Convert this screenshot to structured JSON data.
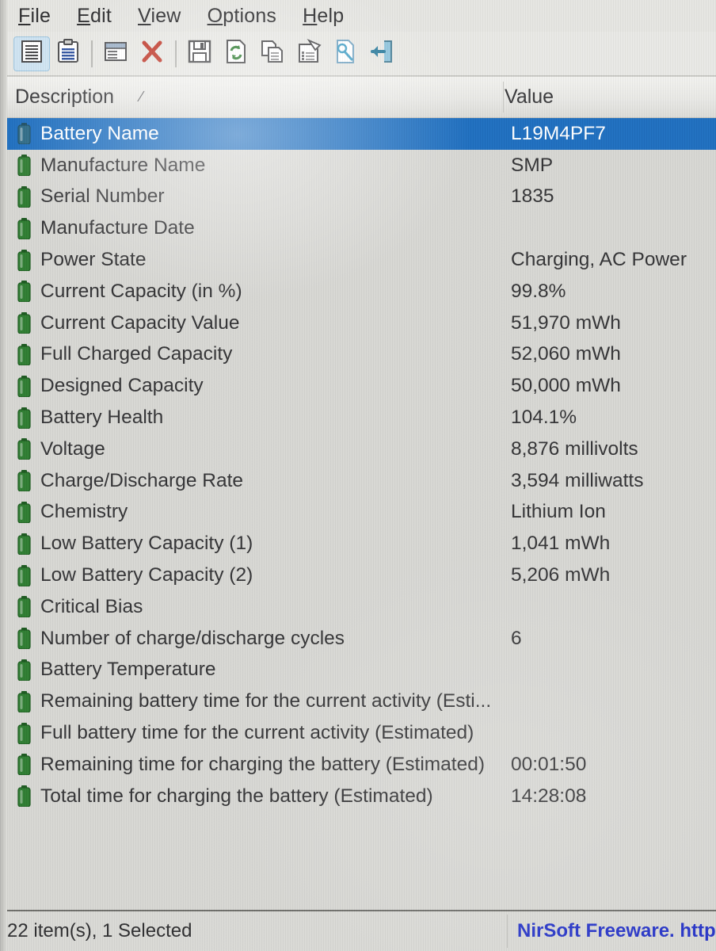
{
  "app": {
    "title": "BatteryInfoView"
  },
  "menubar": {
    "items": [
      {
        "name": "file",
        "label": "File",
        "accel": "F",
        "rest": "ile"
      },
      {
        "name": "edit",
        "label": "Edit",
        "accel": "E",
        "rest": "dit"
      },
      {
        "name": "view",
        "label": "View",
        "accel": "V",
        "rest": "iew"
      },
      {
        "name": "options",
        "label": "Options",
        "accel": "O",
        "rest": "ptions"
      },
      {
        "name": "help",
        "label": "Help",
        "accel": "H",
        "rest": "elp"
      }
    ]
  },
  "toolbar": {
    "buttons": [
      {
        "name": "battery-information-view-button",
        "icon": "list-document-icon",
        "active": true
      },
      {
        "name": "battery-log-view-button",
        "icon": "clipboard-icon",
        "active": false
      },
      {
        "name": "separator-1",
        "icon": "separator",
        "active": false
      },
      {
        "name": "properties-window-button",
        "icon": "window-icon",
        "active": false
      },
      {
        "name": "clear-button",
        "icon": "red-x-icon",
        "active": false
      },
      {
        "name": "separator-2",
        "icon": "separator",
        "active": false
      },
      {
        "name": "save-button",
        "icon": "floppy-save-icon",
        "active": false
      },
      {
        "name": "refresh-button",
        "icon": "refresh-page-icon",
        "active": false
      },
      {
        "name": "copy-button",
        "icon": "copy-pages-icon",
        "active": false
      },
      {
        "name": "properties-button",
        "icon": "properties-icon",
        "active": false
      },
      {
        "name": "html-report-button",
        "icon": "html-report-icon",
        "active": false
      },
      {
        "name": "open-folder-button",
        "icon": "open-export-icon",
        "active": false
      }
    ]
  },
  "listview": {
    "columns": {
      "description": "Description",
      "value": "Value",
      "sort_indicator": "∕"
    },
    "rows": [
      {
        "icon": "battery-icon",
        "description": "Battery Name",
        "value": "L19M4PF7",
        "selected": true
      },
      {
        "icon": "battery-icon",
        "description": "Manufacture Name",
        "value": "SMP",
        "selected": false
      },
      {
        "icon": "battery-icon",
        "description": "Serial Number",
        "value": "1835",
        "selected": false
      },
      {
        "icon": "battery-icon",
        "description": "Manufacture Date",
        "value": "",
        "selected": false
      },
      {
        "icon": "battery-icon",
        "description": "Power State",
        "value": "Charging, AC Power",
        "selected": false
      },
      {
        "icon": "battery-icon",
        "description": "Current Capacity (in %)",
        "value": "99.8%",
        "selected": false
      },
      {
        "icon": "battery-icon",
        "description": "Current Capacity Value",
        "value": "51,970 mWh",
        "selected": false
      },
      {
        "icon": "battery-icon",
        "description": "Full Charged Capacity",
        "value": "52,060 mWh",
        "selected": false
      },
      {
        "icon": "battery-icon",
        "description": "Designed Capacity",
        "value": "50,000 mWh",
        "selected": false
      },
      {
        "icon": "battery-icon",
        "description": "Battery Health",
        "value": "104.1%",
        "selected": false
      },
      {
        "icon": "battery-icon",
        "description": "Voltage",
        "value": "8,876 millivolts",
        "selected": false
      },
      {
        "icon": "battery-icon",
        "description": "Charge/Discharge Rate",
        "value": "3,594 milliwatts",
        "selected": false
      },
      {
        "icon": "battery-icon",
        "description": "Chemistry",
        "value": "Lithium Ion",
        "selected": false
      },
      {
        "icon": "battery-icon",
        "description": "Low Battery Capacity (1)",
        "value": "1,041 mWh",
        "selected": false
      },
      {
        "icon": "battery-icon",
        "description": "Low Battery Capacity (2)",
        "value": "5,206 mWh",
        "selected": false
      },
      {
        "icon": "battery-icon",
        "description": "Critical Bias",
        "value": "",
        "selected": false
      },
      {
        "icon": "battery-icon",
        "description": "Number of charge/discharge cycles",
        "value": "6",
        "selected": false
      },
      {
        "icon": "battery-icon",
        "description": "Battery Temperature",
        "value": "",
        "selected": false
      },
      {
        "icon": "battery-icon",
        "description": "Remaining battery time for the current activity (Esti...",
        "value": "",
        "selected": false
      },
      {
        "icon": "battery-icon",
        "description": "Full battery time for the current activity (Estimated)",
        "value": "",
        "selected": false
      },
      {
        "icon": "battery-icon",
        "description": "Remaining time for charging the battery (Estimated)",
        "value": "00:01:50",
        "selected": false
      },
      {
        "icon": "battery-icon",
        "description": "Total  time for charging the battery (Estimated)",
        "value": "14:28:08",
        "selected": false
      }
    ]
  },
  "statusbar": {
    "item_count_text": "22 item(s), 1 Selected",
    "link_text": "NirSoft Freeware. http"
  },
  "colors": {
    "selection_blue": "#1f6fc0",
    "link_blue": "#2836c8",
    "battery_green": "#2f7d32",
    "battery_selected_teal": "#2d6a86",
    "toolbar_active": "#cfe4f2",
    "window_bg": "#d7d7d3"
  }
}
